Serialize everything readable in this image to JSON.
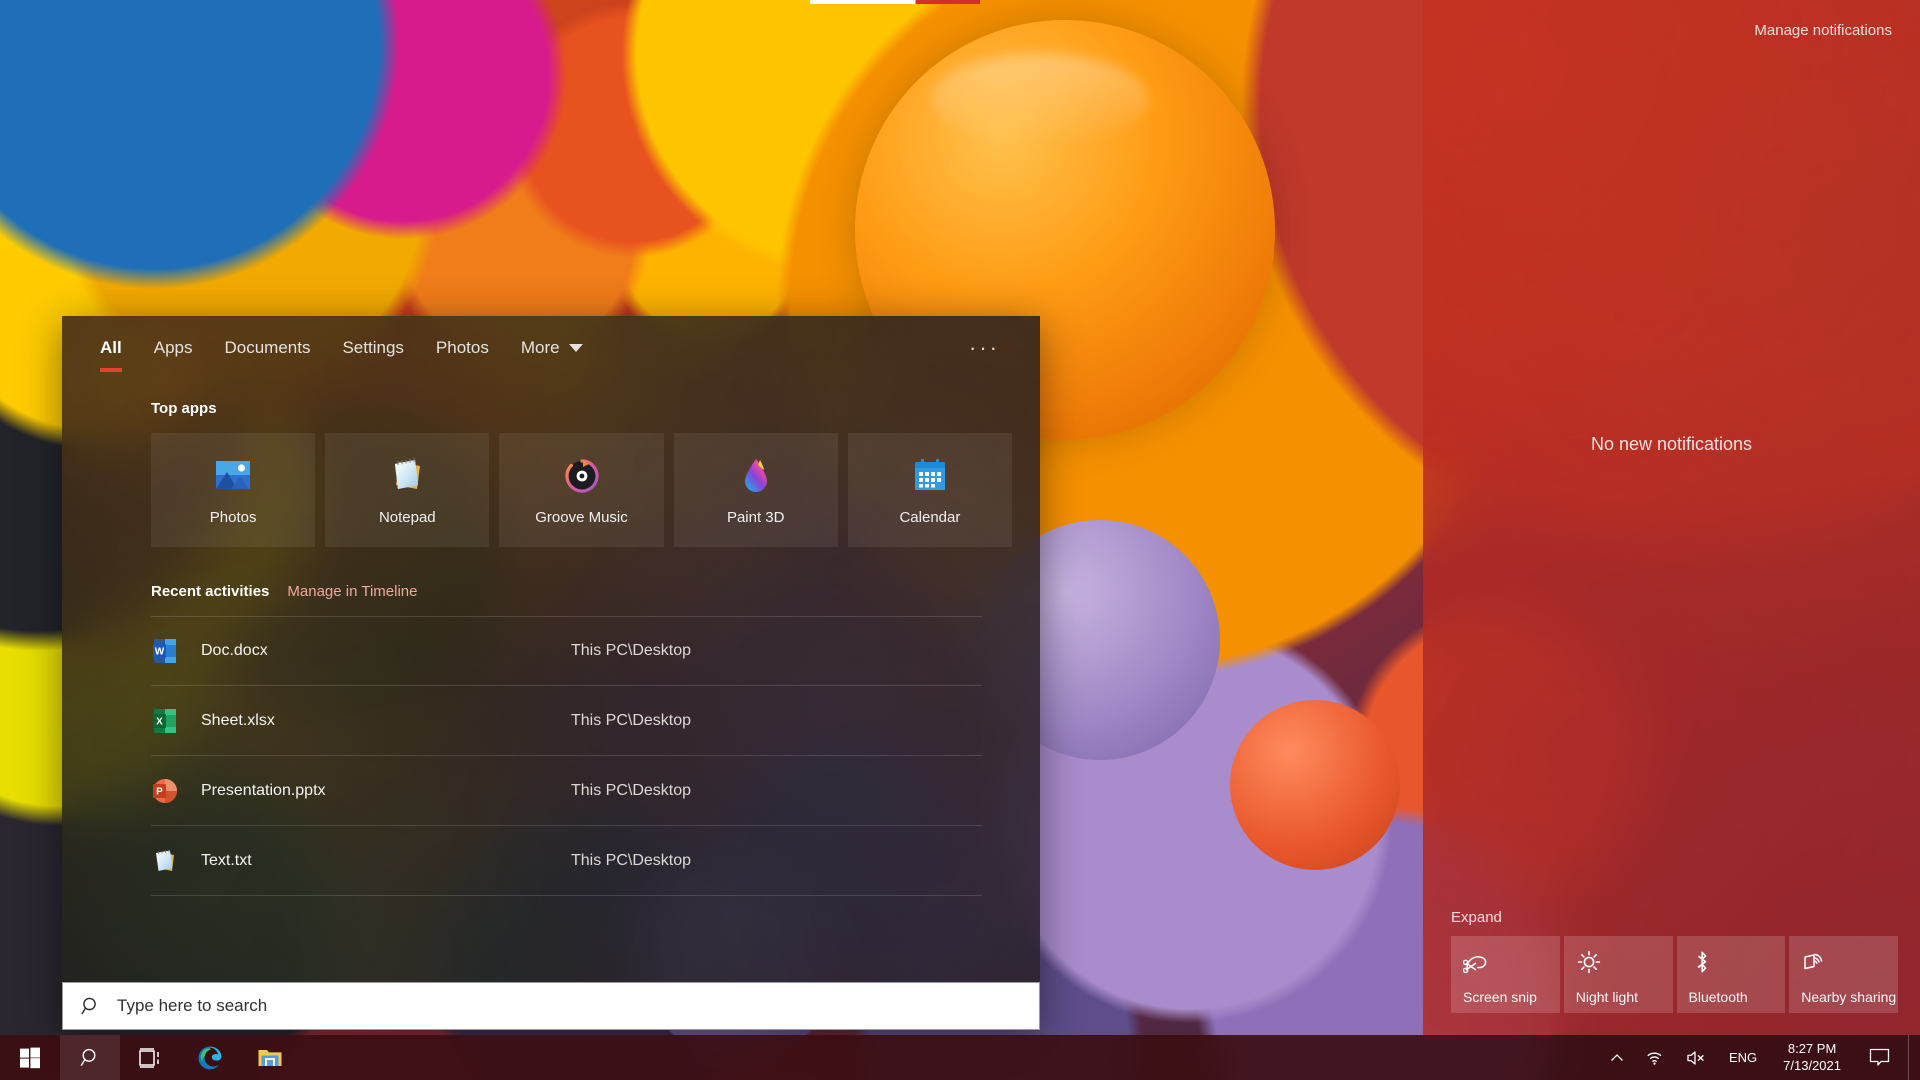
{
  "search_panel": {
    "tabs": [
      {
        "label": "All",
        "active": true,
        "has_caret": false
      },
      {
        "label": "Apps",
        "active": false,
        "has_caret": false
      },
      {
        "label": "Documents",
        "active": false,
        "has_caret": false
      },
      {
        "label": "Settings",
        "active": false,
        "has_caret": false
      },
      {
        "label": "Photos",
        "active": false,
        "has_caret": false
      },
      {
        "label": "More",
        "active": false,
        "has_caret": true
      }
    ],
    "more_options_label": "···",
    "top_apps": {
      "title": "Top apps",
      "items": [
        {
          "label": "Photos",
          "icon": "photos-icon"
        },
        {
          "label": "Notepad",
          "icon": "notepad-icon"
        },
        {
          "label": "Groove Music",
          "icon": "groove-music-icon"
        },
        {
          "label": "Paint 3D",
          "icon": "paint-3d-icon"
        },
        {
          "label": "Calendar",
          "icon": "calendar-icon"
        }
      ]
    },
    "recent_activities": {
      "title": "Recent activities",
      "link_label": "Manage in Timeline",
      "link_color": "#f3a7a0",
      "items": [
        {
          "name": "Doc.docx",
          "location": "This PC\\Desktop",
          "icon": "word-icon"
        },
        {
          "name": "Sheet.xlsx",
          "location": "This PC\\Desktop",
          "icon": "excel-icon"
        },
        {
          "name": "Presentation.pptx",
          "location": "This PC\\Desktop",
          "icon": "powerpoint-icon"
        },
        {
          "name": "Text.txt",
          "location": "This PC\\Desktop",
          "icon": "notepad-icon"
        }
      ]
    },
    "accent_color": "#e8402f"
  },
  "search_box": {
    "placeholder": "Type here to search",
    "value": ""
  },
  "action_center": {
    "manage_label": "Manage notifications",
    "empty_label": "No new notifications",
    "expand_label": "Expand",
    "quick_actions": [
      {
        "label": "Screen snip",
        "icon": "screen-snip-icon"
      },
      {
        "label": "Night light",
        "icon": "night-light-icon"
      },
      {
        "label": "Bluetooth",
        "icon": "bluetooth-icon"
      },
      {
        "label": "Nearby sharing",
        "icon": "nearby-sharing-icon"
      }
    ]
  },
  "taskbar": {
    "buttons": [
      {
        "name": "start",
        "icon": "windows-logo-icon"
      },
      {
        "name": "search",
        "icon": "search-icon"
      },
      {
        "name": "task-view",
        "icon": "task-view-icon"
      },
      {
        "name": "edge",
        "icon": "edge-icon"
      },
      {
        "name": "file-explorer",
        "icon": "file-explorer-icon"
      }
    ],
    "tray": {
      "overflow_icon": "chevron-up-icon",
      "network_icon": "wifi-icon",
      "volume_icon": "speaker-muted-icon",
      "language": "ENG",
      "time": "8:27 PM",
      "date": "7/13/2021",
      "action_center_icon": "action-center-icon"
    }
  }
}
